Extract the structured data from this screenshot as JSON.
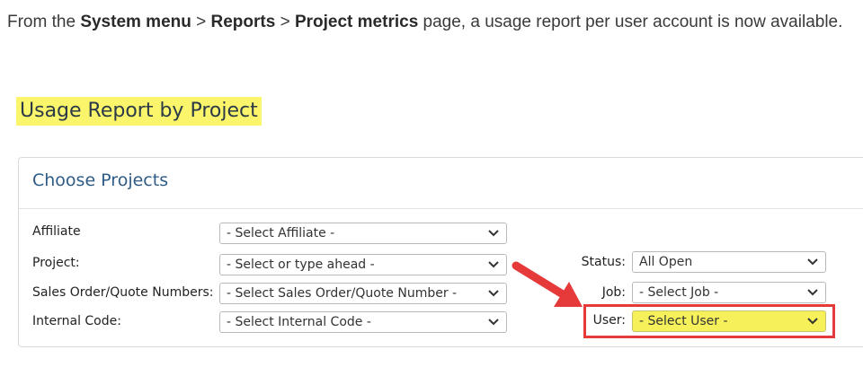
{
  "intro": {
    "text_1": "From the ",
    "bold_1": "System menu",
    "text_2": " > ",
    "bold_2": "Reports",
    "text_3": " > ",
    "bold_3": "Project metrics",
    "text_4": " page, a usage report per user account is now available."
  },
  "heading": "Usage Report by Project",
  "panel": {
    "title": "Choose Projects",
    "fields": {
      "affiliate": {
        "label": "Affiliate",
        "value": "- Select Affiliate -"
      },
      "project": {
        "label": "Project:",
        "value": "- Select or type ahead -"
      },
      "sales_order": {
        "label": "Sales Order/Quote Numbers:",
        "value": "- Select Sales Order/Quote Number -"
      },
      "internal_code": {
        "label": "Internal Code:",
        "value": "- Select Internal Code -"
      },
      "status": {
        "label": "Status:",
        "value": "All Open"
      },
      "job": {
        "label": "Job:",
        "value": "- Select Job -"
      },
      "user": {
        "label": "User:",
        "value": "- Select User -"
      }
    }
  },
  "colors": {
    "highlight": "#faf56a",
    "callout": "#e63a3a",
    "title": "#2f5b86"
  },
  "icons": {
    "dropdown": "chevron-down-icon",
    "annotation": "arrow-icon"
  }
}
